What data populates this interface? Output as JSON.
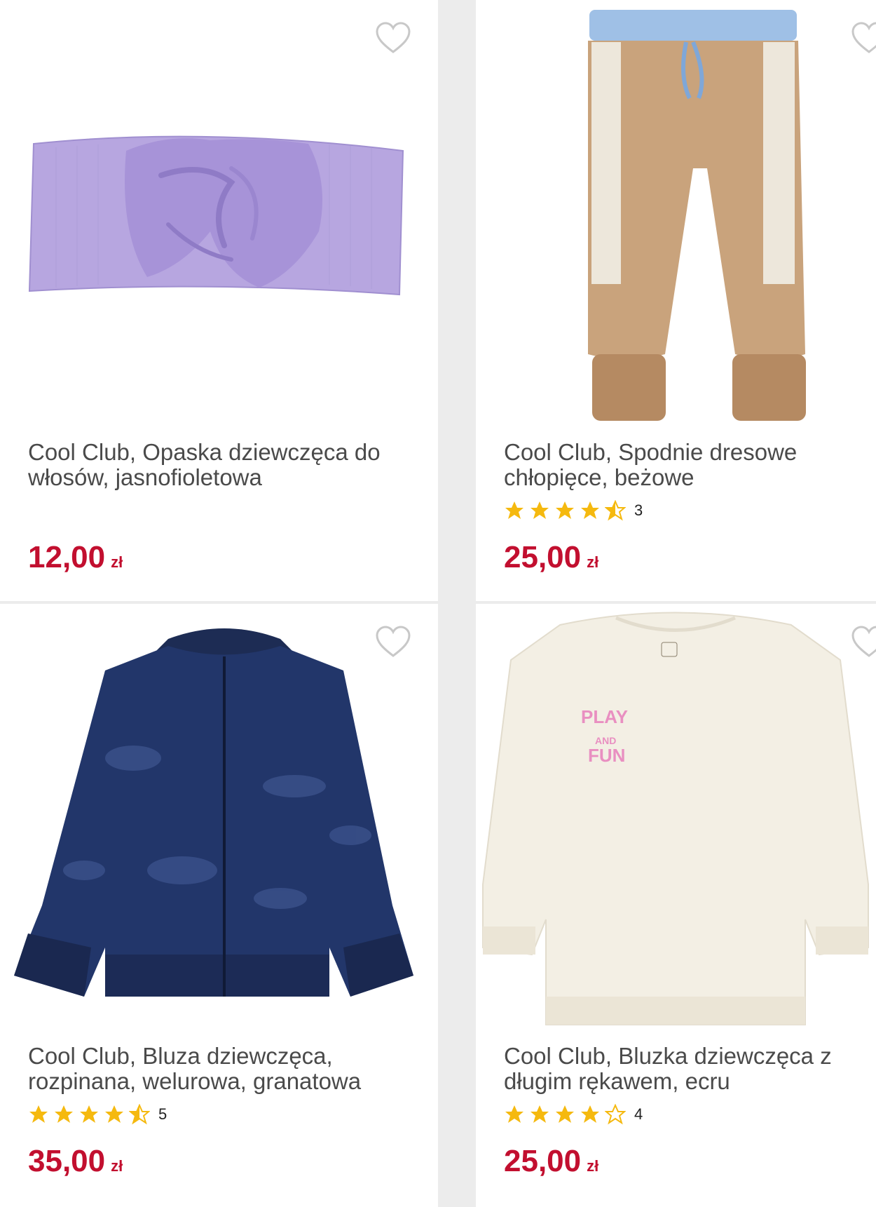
{
  "products": [
    {
      "title_line1": "Cool Club, Opaska dziewczęca do",
      "title_line2": "włosów, jasnofioletowa",
      "price": "12,00",
      "currency": "zł",
      "rating_count": ""
    },
    {
      "title_line1": "Cool Club, Spodnie dresowe",
      "title_line2": "chłopięce, beżowe",
      "price": "25,00",
      "currency": "zł",
      "rating_count": "3",
      "rating": 4.5
    },
    {
      "title_line1": "Cool Club, Bluza dziewczęca,",
      "title_line2": "rozpinana, welurowa, granatowa",
      "price": "35,00",
      "currency": "zł",
      "rating_count": "5",
      "rating": 4.5
    },
    {
      "title_line1": "Cool Club, Bluzka dziewczęca z",
      "title_line2": "długim rękawem, ecru",
      "price": "25,00",
      "currency": "zł",
      "rating_count": "4",
      "rating": 4
    }
  ],
  "icons": {
    "favorite": "heart-outline-icon",
    "star": "star-icon"
  },
  "colors": {
    "price": "#c20f2f",
    "star": "#f5b90f",
    "text": "#4a4a4a"
  }
}
